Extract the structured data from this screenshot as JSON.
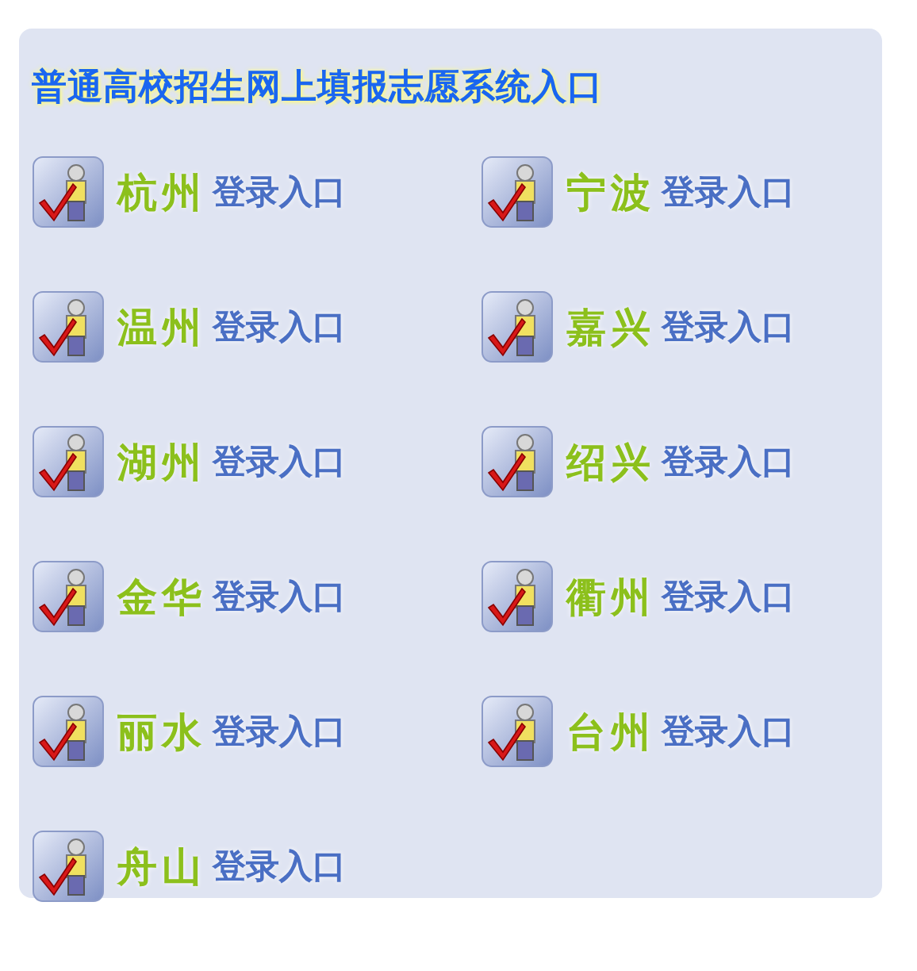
{
  "title": "普通高校招生网上填报志愿系统入口",
  "entries": [
    {
      "city": "杭州",
      "label": "登录入口"
    },
    {
      "city": "宁波",
      "label": "登录入口"
    },
    {
      "city": "温州",
      "label": "登录入口"
    },
    {
      "city": "嘉兴",
      "label": "登录入口"
    },
    {
      "city": "湖州",
      "label": "登录入口"
    },
    {
      "city": "绍兴",
      "label": "登录入口"
    },
    {
      "city": "金华",
      "label": "登录入口"
    },
    {
      "city": "衢州",
      "label": "登录入口"
    },
    {
      "city": "丽水",
      "label": "登录入口"
    },
    {
      "city": "台州",
      "label": "登录入口"
    },
    {
      "city": "舟山",
      "label": "登录入口"
    }
  ]
}
